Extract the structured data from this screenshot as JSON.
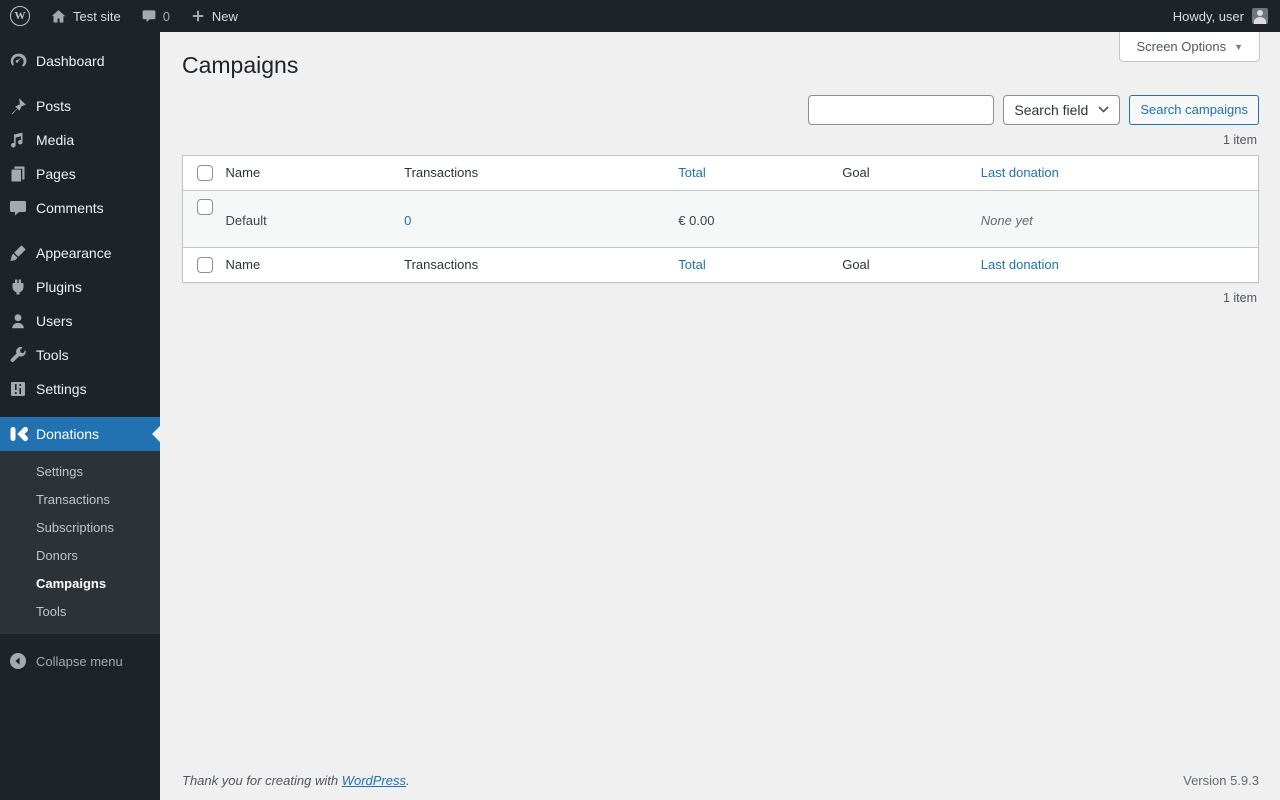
{
  "colors": {
    "accent": "#2271b1",
    "menu_bg": "#1d2327",
    "submenu_bg": "#2c3338",
    "content_bg": "#f0f0f1"
  },
  "admin_bar": {
    "site_name": "Test site",
    "comments_count": "0",
    "new_label": "New",
    "howdy_text": "Howdy, user",
    "wp_logo_letter": "W"
  },
  "sidebar": {
    "items": [
      {
        "label": "Dashboard",
        "icon": "dashboard-icon"
      },
      {
        "label": "Posts",
        "icon": "pin-icon"
      },
      {
        "label": "Media",
        "icon": "media-icon"
      },
      {
        "label": "Pages",
        "icon": "pages-icon"
      },
      {
        "label": "Comments",
        "icon": "comment-icon"
      },
      {
        "label": "Appearance",
        "icon": "brush-icon"
      },
      {
        "label": "Plugins",
        "icon": "plugin-icon"
      },
      {
        "label": "Users",
        "icon": "user-icon"
      },
      {
        "label": "Tools",
        "icon": "wrench-icon"
      },
      {
        "label": "Settings",
        "icon": "sliders-icon"
      }
    ],
    "donations": {
      "label": "Donations",
      "icon": "kudos-logo-icon"
    },
    "submenu": [
      {
        "label": "Settings"
      },
      {
        "label": "Transactions"
      },
      {
        "label": "Subscriptions"
      },
      {
        "label": "Donors"
      },
      {
        "label": "Campaigns"
      },
      {
        "label": "Tools"
      }
    ],
    "active_submenu": "Campaigns",
    "collapse_label": "Collapse menu"
  },
  "page": {
    "title": "Campaigns",
    "screen_options_label": "Screen Options",
    "search": {
      "value": "",
      "field_selected": "Search field",
      "button_label": "Search campaigns"
    },
    "item_count_top": "1 item",
    "item_count_bottom": "1 item",
    "table": {
      "headers": {
        "name": "Name",
        "transactions": "Transactions",
        "total": "Total",
        "goal": "Goal",
        "last_donation": "Last donation"
      },
      "sortable": [
        "Total",
        "Last donation"
      ],
      "rows": [
        {
          "name": "Default",
          "transactions": "0",
          "total": "€ 0.00",
          "goal": "",
          "last_donation": "None yet"
        }
      ]
    },
    "footer": {
      "thanks_prefix": "Thank you for creating with ",
      "link_text": "WordPress",
      "suffix": ".",
      "version": "Version 5.9.3"
    }
  }
}
